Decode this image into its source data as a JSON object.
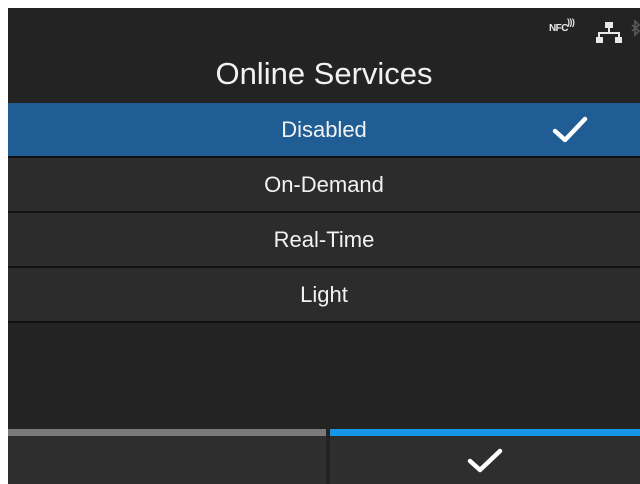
{
  "status": {
    "nfc_label": "NFC",
    "icons": [
      "nfc-icon",
      "network-icon",
      "bluetooth-icon"
    ]
  },
  "header": {
    "title": "Online Services"
  },
  "menu": {
    "items": [
      {
        "label": "Disabled",
        "selected": true
      },
      {
        "label": "On-Demand",
        "selected": false
      },
      {
        "label": "Real-Time",
        "selected": false
      },
      {
        "label": "Light",
        "selected": false
      }
    ]
  },
  "footer": {
    "left_key": "",
    "right_key_icon": "checkmark-icon"
  },
  "colors": {
    "background": "#232323",
    "selected_row": "#1f5d94",
    "accent_bar": "#1596e6",
    "inactive_bar": "#7a7a7a"
  }
}
